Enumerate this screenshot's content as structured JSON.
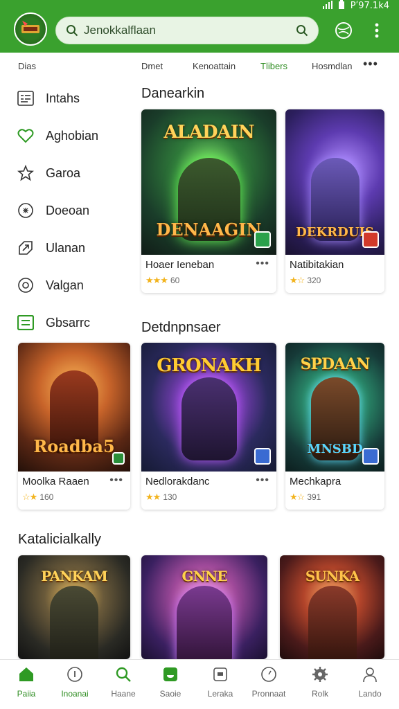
{
  "status": {
    "time": "Pʹ97.1k4"
  },
  "header": {
    "logo_text": "",
    "search_value": "Jenokkalflaan"
  },
  "tabs": [
    {
      "label": "Dias"
    },
    {
      "label": "Dmet"
    },
    {
      "label": "Kenoattain"
    },
    {
      "label": "Tlibers"
    },
    {
      "label": "Hosmdlan"
    }
  ],
  "tabs_more": "•••",
  "sidebar": {
    "items": [
      {
        "label": "Intahs",
        "icon": "list-icon"
      },
      {
        "label": "Aghobian",
        "icon": "heart-icon"
      },
      {
        "label": "Garoa",
        "icon": "star-icon"
      },
      {
        "label": "Doeoan",
        "icon": "puzzle-icon"
      },
      {
        "label": "Ulanan",
        "icon": "arrow-icon"
      },
      {
        "label": "Valgan",
        "icon": "target-icon"
      },
      {
        "label": "Gbsarrc",
        "icon": "box-icon"
      }
    ]
  },
  "sections": {
    "s1": "Danearkin",
    "s2": "Detdnpnsaer",
    "s3": "Katalicialkally"
  },
  "cards": [
    {
      "art_title": "ALADAIN",
      "art_sub": "DENAAGIN",
      "name": "Hoaer Ieneban",
      "stars": "★★★",
      "count": "60"
    },
    {
      "art_title": "",
      "art_sub": "DEKRDUIS",
      "name": "Natibitakian",
      "stars": "★☆",
      "count": "320"
    },
    {
      "art_title": "",
      "art_sub": "Roadba5",
      "name": "Moolka Raaen",
      "stars": "☆★",
      "count": "160"
    },
    {
      "art_title": "GRONAKH",
      "art_sub": "",
      "name": "Nedlorakdanc",
      "stars": "★★",
      "count": "130"
    },
    {
      "art_title": "SPDAAN",
      "art_sub": "MNSBD",
      "name": "Mechkapra",
      "stars": "★☆",
      "count": "391"
    },
    {
      "art_title": "PANKAM",
      "art_sub": "",
      "name": "",
      "stars": "",
      "count": ""
    },
    {
      "art_title": "GNNE",
      "art_sub": "",
      "name": "",
      "stars": "",
      "count": ""
    },
    {
      "art_title": "SUNKA",
      "art_sub": "",
      "name": "",
      "stars": "",
      "count": ""
    }
  ],
  "card_more": "•••",
  "bottom_nav": [
    {
      "label": "Paiia",
      "icon": "home-icon",
      "active": true
    },
    {
      "label": "Inoanai",
      "icon": "info-icon",
      "active": true
    },
    {
      "label": "Haane",
      "icon": "search-icon",
      "active": false
    },
    {
      "label": "Saoie",
      "icon": "game-icon",
      "active": false
    },
    {
      "label": "Leraka",
      "icon": "store-icon",
      "active": false
    },
    {
      "label": "Pronnaat",
      "icon": "clock-icon",
      "active": false
    },
    {
      "label": "Rolk",
      "icon": "gear-icon",
      "active": false
    },
    {
      "label": "Lando",
      "icon": "profile-icon",
      "active": false
    }
  ],
  "colors": {
    "brand": "#3aa12e",
    "accent_text": "#2f8d22",
    "star": "#f2b31c"
  }
}
